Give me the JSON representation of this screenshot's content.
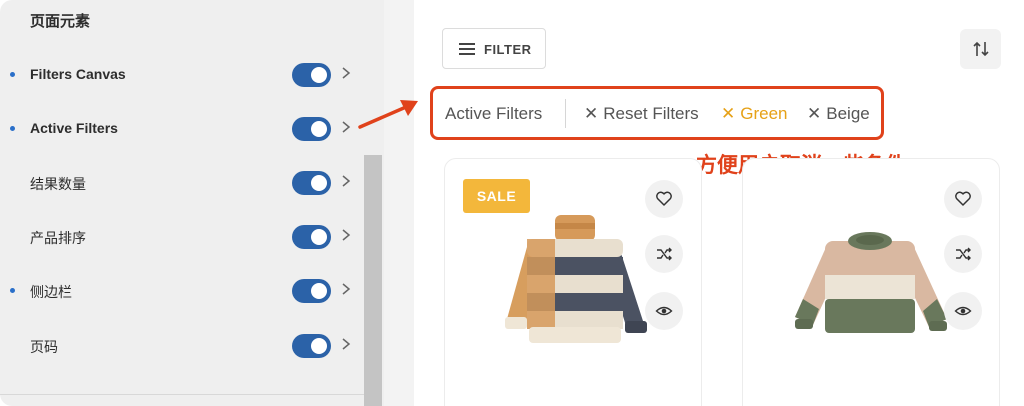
{
  "panel": {
    "title": "页面元素",
    "items": [
      {
        "label": "Filters Canvas",
        "dot": true,
        "enabled": true
      },
      {
        "label": "Active Filters",
        "dot": true,
        "enabled": true
      },
      {
        "label": "结果数量",
        "dot": false,
        "enabled": true
      },
      {
        "label": "产品排序",
        "dot": false,
        "enabled": true
      },
      {
        "label": "侧边栏",
        "dot": true,
        "enabled": true
      },
      {
        "label": "页码",
        "dot": false,
        "enabled": true
      }
    ]
  },
  "shop": {
    "filter_label": "FILTER",
    "active_filters": {
      "label": "Active Filters",
      "chips": [
        {
          "text": "Reset Filters",
          "style": "default"
        },
        {
          "text": "Green",
          "style": "highlight"
        },
        {
          "text": "Beige",
          "style": "default"
        }
      ]
    },
    "annotation": "方便用户取消一些条件",
    "products": [
      {
        "badge": "SALE"
      },
      {
        "badge": ""
      }
    ]
  },
  "colors": {
    "accent_red": "#e0421b",
    "toggle_blue": "#2b62a8",
    "sale_yellow": "#f3b73b",
    "green_chip": "#e6a117"
  }
}
